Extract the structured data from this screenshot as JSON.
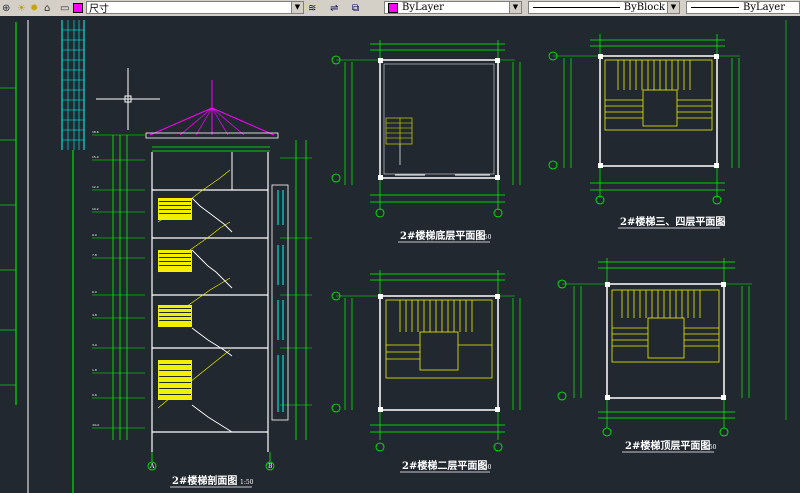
{
  "toolbar": {
    "layer_value": "尺寸",
    "color_value": "ByLayer",
    "linetype_value": "ByBlock",
    "lineweight_value": "ByLayer",
    "layer_swatch": "#ff00ff"
  },
  "drawings": {
    "section_title": "2#楼梯剖面图",
    "section_scale": "1:50",
    "ground_title": "2#楼梯底层平面图",
    "ground_scale": "1:50",
    "second_title": "2#楼梯二层平面图",
    "second_scale": "1:50",
    "third_title": "2#楼梯三、四层平面图",
    "third_scale": "1:50",
    "top_title": "2#楼梯顶层平面图",
    "top_scale": "1:50",
    "grid_a": "A",
    "grid_b": "B",
    "grid_1": "1",
    "grid_2": "2"
  },
  "colors": {
    "background": "#212830",
    "stair": "#f0f000",
    "dimension": "#00ff00",
    "wall": "#ffffff",
    "window": "#00ffff",
    "roof": "#ff00ff"
  }
}
